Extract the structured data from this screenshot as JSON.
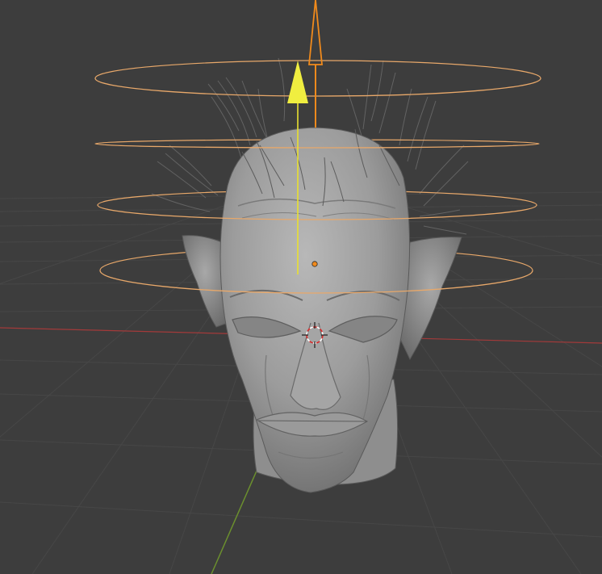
{
  "viewport": {
    "background_color": "#3d3d3d",
    "grid_color": "#474747",
    "x_axis_color": "#a33a3a",
    "y_axis_color": "#6b8f2e",
    "selection_color": "#e8a86a",
    "active_color": "#f08a1c",
    "gizmo_color": "#e8e030"
  },
  "scene": {
    "mesh": "sculpted-head",
    "particles": "hair-strands",
    "force_field": "vortex-empty-rings",
    "cursor": "3d-cursor-icon",
    "origin": "object-origin-dot",
    "gizmo": "move-z-arrow-gizmo"
  }
}
